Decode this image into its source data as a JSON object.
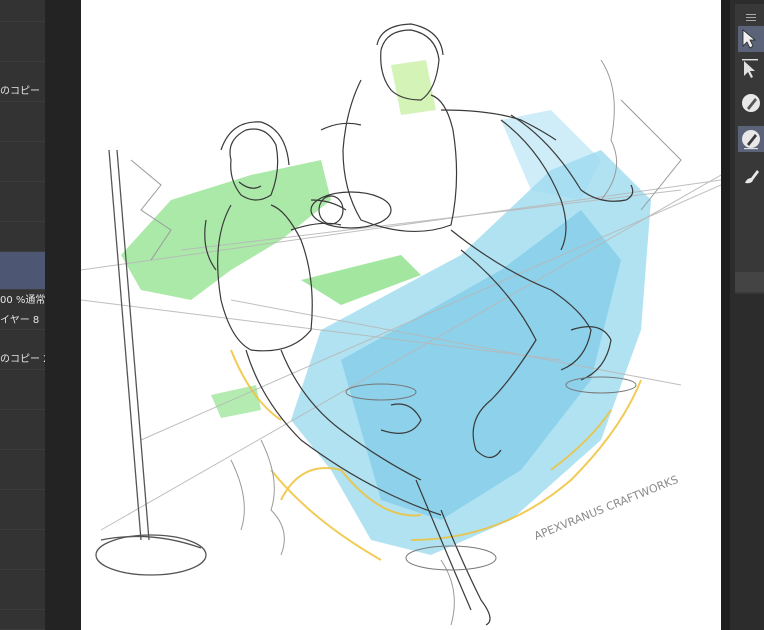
{
  "layers": {
    "rows": [
      {
        "label": ""
      },
      {
        "label": "のコピー"
      },
      {
        "label": ""
      },
      {
        "label": ""
      },
      {
        "label": ""
      },
      {
        "label": ""
      },
      {
        "label": ""
      },
      {
        "label": "00 %通常",
        "label2": "イヤー 8"
      },
      {
        "label": "のコピー 2"
      },
      {
        "label": ""
      },
      {
        "label": ""
      },
      {
        "label": ""
      },
      {
        "label": ""
      },
      {
        "label": ""
      },
      {
        "label": ""
      }
    ]
  },
  "canvas": {
    "signature": "APEXVRANUS  CRAFTWORKS"
  },
  "tools": [
    {
      "icon": "object-select-icon",
      "active": true
    },
    {
      "icon": "layer-move-icon",
      "active": false
    },
    {
      "icon": "pen-icon",
      "active": false
    },
    {
      "icon": "pencil-icon",
      "active": true
    },
    {
      "icon": "brush-icon",
      "active": false
    }
  ],
  "colors": {
    "selected_layer": "#4d5774",
    "active_tool": "#5a6378",
    "sketch_blue": "#3fb8e0",
    "sketch_green": "#3fcc3a",
    "sketch_yellow": "#f0c23a"
  }
}
